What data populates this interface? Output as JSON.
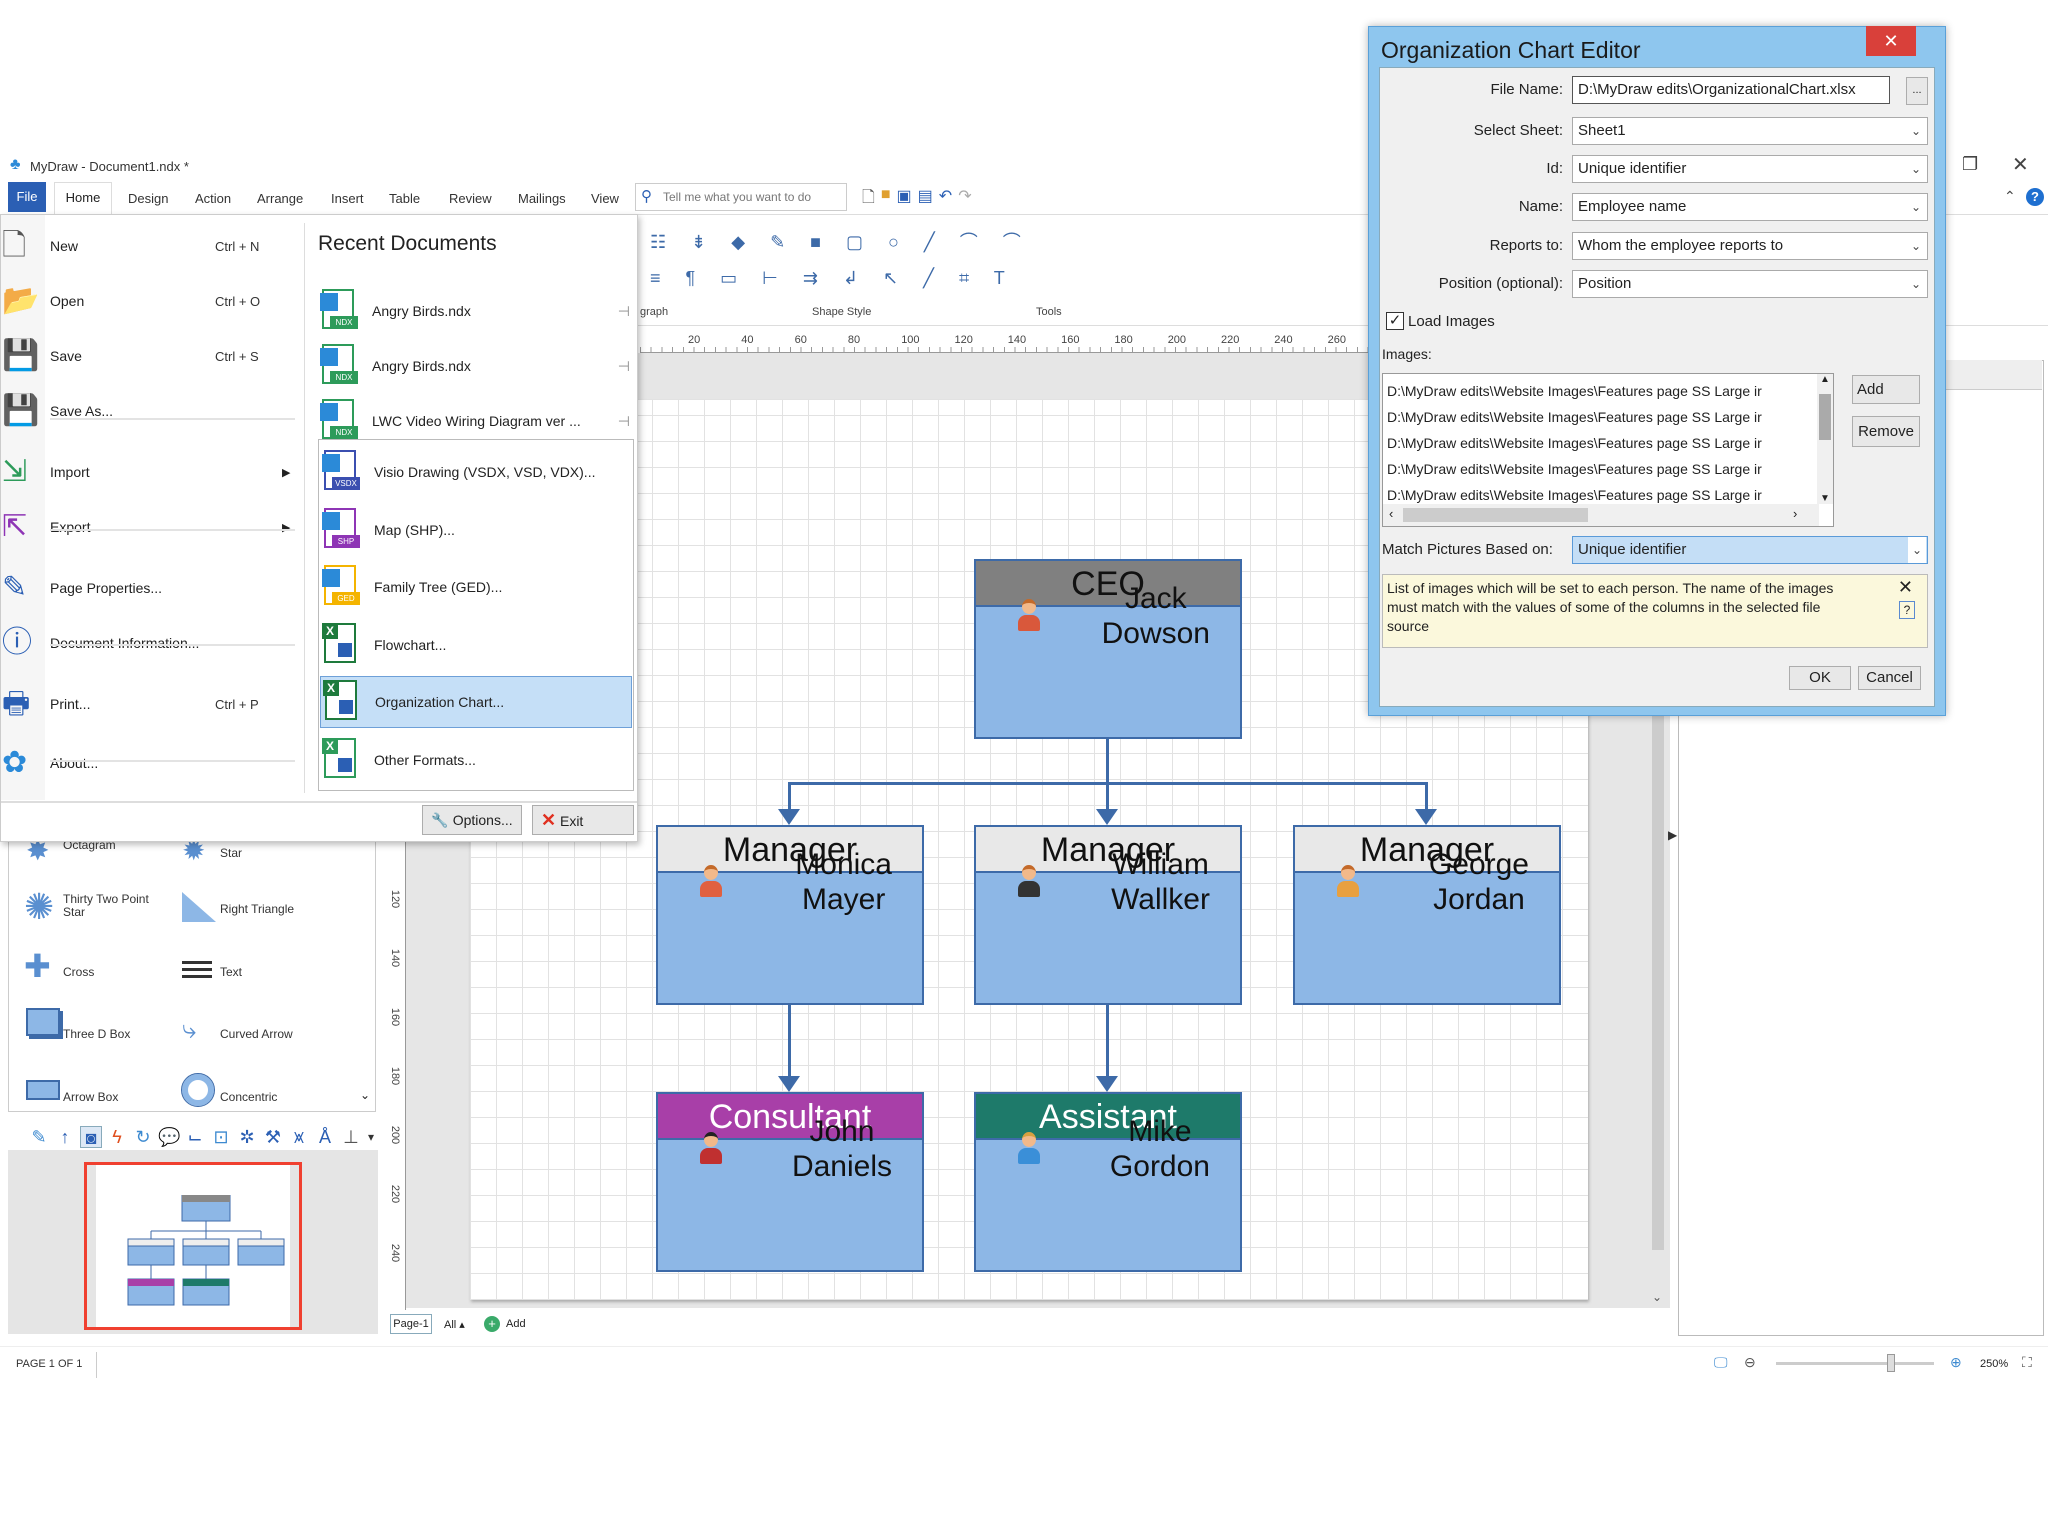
{
  "app": {
    "title": "MyDraw - Document1.ndx *"
  },
  "ribbon": {
    "tabs": [
      "File",
      "Home",
      "Design",
      "Action",
      "Arrange",
      "Insert",
      "Table",
      "Review",
      "Mailings",
      "View"
    ],
    "search_placeholder": "Tell me what you want to do",
    "groups": [
      "graph",
      "Shape Style",
      "Tools"
    ]
  },
  "file_menu": {
    "items": [
      {
        "label": "New",
        "shortcut": "Ctrl + N"
      },
      {
        "label": "Open",
        "shortcut": "Ctrl + O"
      },
      {
        "label": "Save",
        "shortcut": "Ctrl + S"
      },
      {
        "label": "Save As...",
        "shortcut": ""
      },
      {
        "label": "Import",
        "shortcut": ""
      },
      {
        "label": "Export",
        "shortcut": ""
      },
      {
        "label": "Page Properties...",
        "shortcut": ""
      },
      {
        "label": "Document Information...",
        "shortcut": ""
      },
      {
        "label": "Print...",
        "shortcut": "Ctrl + P"
      },
      {
        "label": "About...",
        "shortcut": ""
      }
    ],
    "recent_title": "Recent Documents",
    "recent": [
      "Angry Birds.ndx",
      "Angry Birds.ndx",
      "LWC Video Wiring Diagram ver ..."
    ],
    "import_formats": [
      {
        "label": "Visio Drawing (VSDX, VSD, VDX)...",
        "tag": "VSDX",
        "color": "#3b4fb0"
      },
      {
        "label": "Map (SHP)...",
        "tag": "SHP",
        "color": "#8e35b5"
      },
      {
        "label": "Family Tree (GED)...",
        "tag": "GED",
        "color": "#f4b400"
      },
      {
        "label": "Flowchart...",
        "tag": "",
        "color": "#1e7a3c"
      },
      {
        "label": "Organization Chart...",
        "tag": "",
        "color": "#1e7a3c"
      },
      {
        "label": "Other Formats...",
        "tag": "",
        "color": "#2d9b5a"
      }
    ],
    "ndx_tag": "NDX",
    "options_label": "Options...",
    "exit_label": "Exit"
  },
  "shapes": [
    "Octagram",
    "Star",
    "Thirty Two Point Star",
    "Right Triangle",
    "Cross",
    "Text",
    "Three D Box",
    "Curved Arrow",
    "Arrow Box",
    "Concentric"
  ],
  "ruler": {
    "h": [
      "20",
      "40",
      "60",
      "80",
      "100",
      "120",
      "140",
      "160",
      "180",
      "200",
      "220",
      "240",
      "260"
    ],
    "v": [
      "120",
      "140",
      "160",
      "180",
      "200",
      "220",
      "240"
    ]
  },
  "org": {
    "ceo": {
      "title": "CEO",
      "name1": "Jack",
      "name2": "Dowson"
    },
    "m1": {
      "title": "Manager",
      "name1": "Monica",
      "name2": "Mayer"
    },
    "m2": {
      "title": "Manager",
      "name1": "William",
      "name2": "Wallker"
    },
    "m3": {
      "title": "Manager",
      "name1": "George",
      "name2": "Jordan"
    },
    "c1": {
      "title": "Consultant",
      "name1": "John",
      "name2": "Daniels"
    },
    "a1": {
      "title": "Assistant",
      "name1": "Mike",
      "name2": "Gordon"
    },
    "colors": {
      "manager_header": "#e8e8e8",
      "ceo_header": "#808080",
      "consultant_header": "#a83fa8",
      "assistant_header": "#1e7a6a",
      "body": "#8db7e6"
    }
  },
  "pages": {
    "tab": "Page-1",
    "all": "All",
    "add": "Add"
  },
  "status": {
    "page": "PAGE 1 OF 1",
    "zoom": "250%",
    "zoom_fraction": 0.7
  },
  "dialog": {
    "title": "Organization Chart Editor",
    "file_name_label": "File Name:",
    "file_name": "D:\\MyDraw edits\\OrganizationalChart.xlsx",
    "browse": "...",
    "sheet_label": "Select Sheet:",
    "sheet": "Sheet1",
    "id_label": "Id:",
    "id": "Unique identifier",
    "name_label": "Name:",
    "name": "Employee name",
    "reports_label": "Reports to:",
    "reports": "Whom the employee reports to",
    "position_label": "Position (optional):",
    "position": "Position",
    "load_images_label": "Load Images",
    "load_images_checked": true,
    "images_label": "Images:",
    "images": [
      "D:\\MyDraw edits\\Website Images\\Features page SS Large ir",
      "D:\\MyDraw edits\\Website Images\\Features page SS Large ir",
      "D:\\MyDraw edits\\Website Images\\Features page SS Large ir",
      "D:\\MyDraw edits\\Website Images\\Features page SS Large ir",
      "D:\\MyDraw edits\\Website Images\\Features page SS Large ir"
    ],
    "add": "Add",
    "remove": "Remove",
    "match_label": "Match Pictures Based on:",
    "match": "Unique identifier",
    "info": "List of images which will be set to each person. The name of the images must match with the values of some of the columns in the selected file source",
    "ok": "OK",
    "cancel": "Cancel"
  }
}
